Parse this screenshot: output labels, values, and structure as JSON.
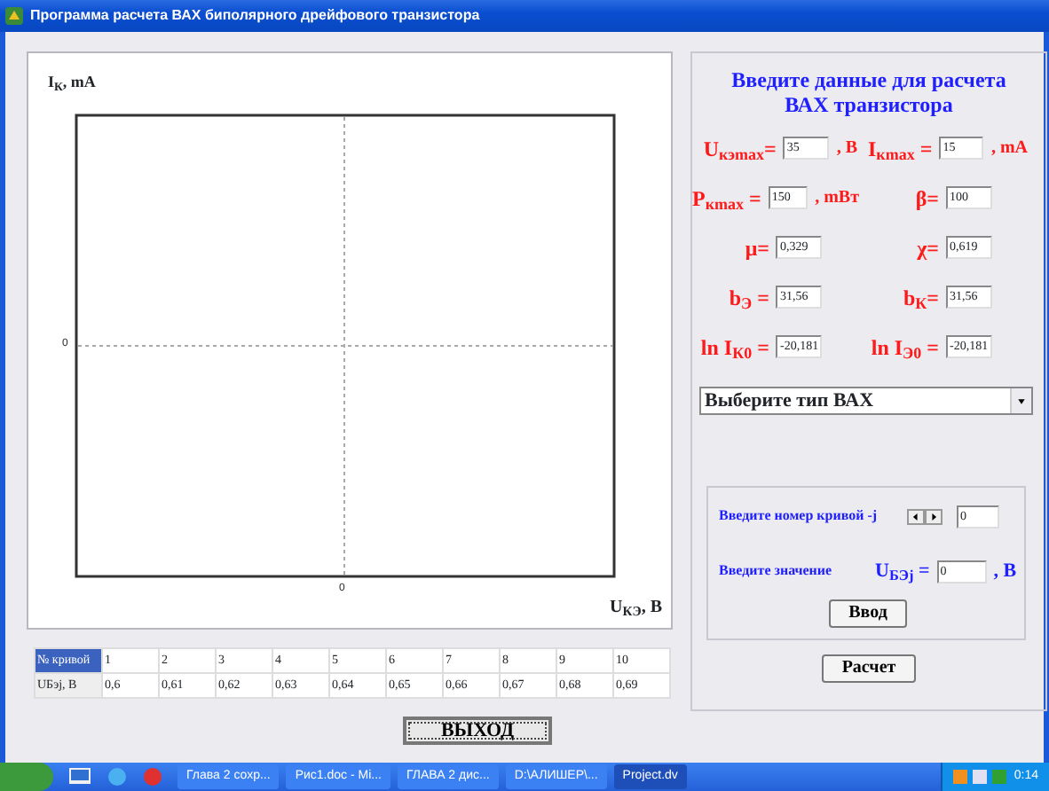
{
  "window": {
    "title": "Программа расчета ВАХ биполярного дрейфового транзистора"
  },
  "chart": {
    "y_label": "I$_{К}$, mA",
    "y_tick": "0",
    "x_tick": "0",
    "x_label": "U$_{КЭ}$, В"
  },
  "form": {
    "heading": "Введите данные для расчета ВАХ транзистора",
    "rows": [
      [
        {
          "label": "U$_{кэmax}$=",
          "value": "35",
          "unit": ", В"
        },
        {
          "label": "I$_{кmax}$ =",
          "value": "15",
          "unit": ", mA"
        }
      ],
      [
        {
          "label": "P$_{кmax}$ =",
          "value": "150",
          "unit": ", mВт"
        },
        {
          "label": "β=",
          "value": "100"
        }
      ],
      [
        {
          "label": "μ=",
          "value": "0,329"
        },
        {
          "label": "χ=",
          "value": "0,619"
        }
      ],
      [
        {
          "label": "b$_{Э}$ =",
          "value": "31,56"
        },
        {
          "label": "b$_{К}$=",
          "value": "31,56"
        }
      ],
      [
        {
          "label": "ln I$_{К0}$ =",
          "value": "-20,181"
        },
        {
          "label": "ln I$_{Э0}$ =",
          "value": "-20,181"
        }
      ]
    ],
    "dropdown": "Выберите тип ВАХ"
  },
  "input_panel": {
    "curve_label": "Введите номер кривой -j",
    "curve_value": "0",
    "value_label": "Введите значение",
    "u_label": "U$_{БЭj}$ =",
    "u_value": "0",
    "u_unit": ", В",
    "enter_button": "Ввод"
  },
  "calc_button": "Расчет",
  "table": {
    "rows": [
      {
        "header": "№ кривой",
        "header_selected": true,
        "cells": [
          "1",
          "2",
          "3",
          "4",
          "5",
          "6",
          "7",
          "8",
          "9",
          "10"
        ]
      },
      {
        "header": "UБэj, В",
        "header_selected": false,
        "cells": [
          "0,6",
          "0,61",
          "0,62",
          "0,63",
          "0,64",
          "0,65",
          "0,66",
          "0,67",
          "0,68",
          "0,69"
        ]
      }
    ]
  },
  "exit_button": "ВЫХОД",
  "taskbar": {
    "tasks": [
      {
        "label": "Глава 2 сохр...",
        "active": false
      },
      {
        "label": "Рис1.doc - Mi...",
        "active": false
      },
      {
        "label": "ГЛАВА 2 дис...",
        "active": false
      },
      {
        "label": "D:\\АЛИШЕР\\...",
        "active": false
      },
      {
        "label": "Project.dv",
        "active": true
      }
    ],
    "clock": "0:14"
  }
}
